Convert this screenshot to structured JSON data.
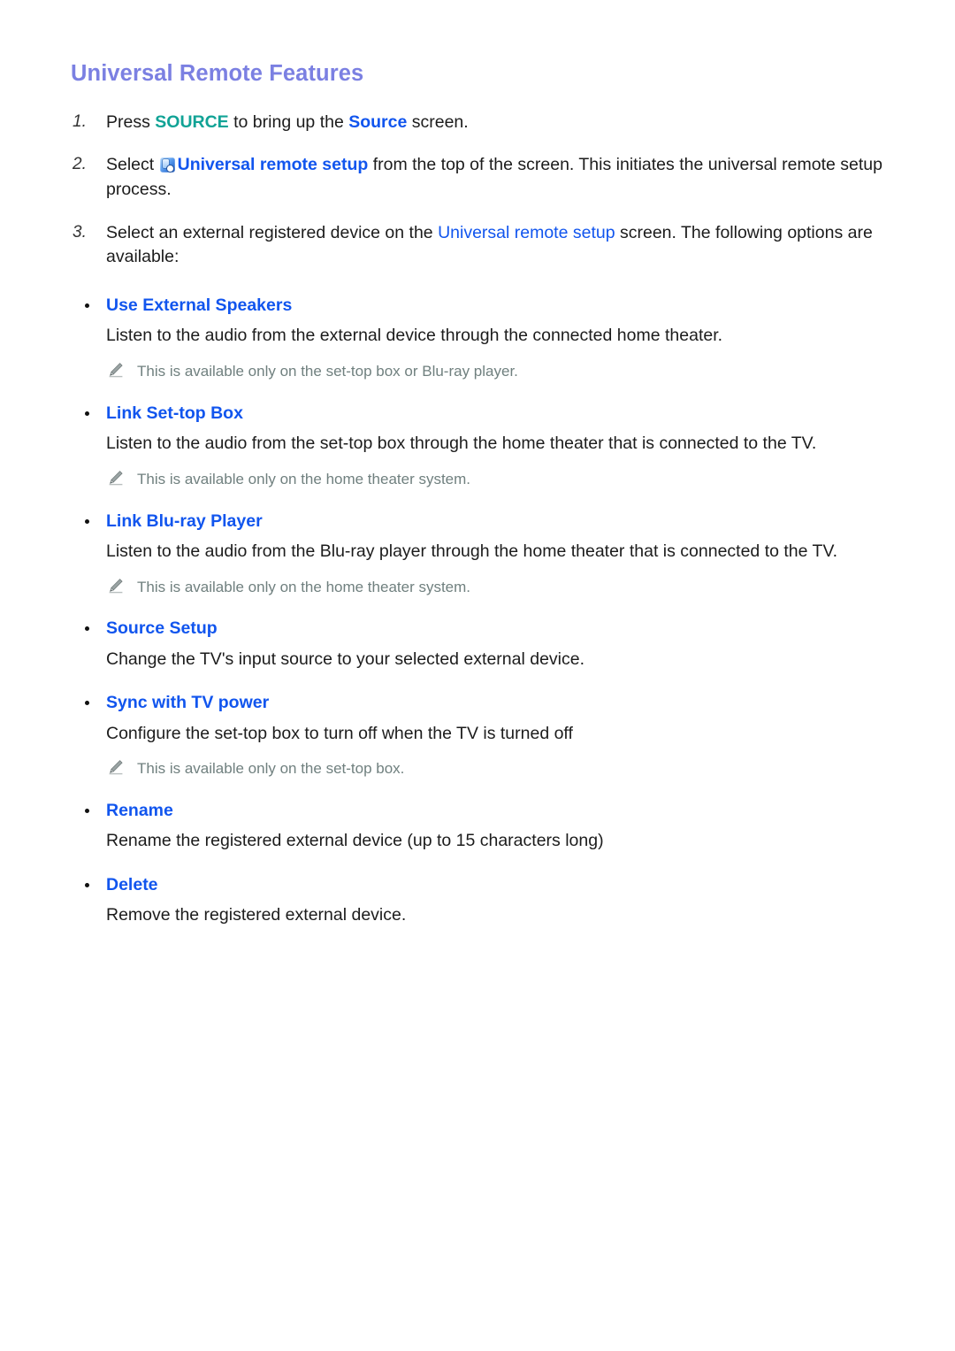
{
  "document": {
    "title": "Universal Remote Features"
  },
  "steps": [
    {
      "number": "1.",
      "pre": "Press ",
      "kw_teal": "SOURCE",
      "mid": " to bring up the ",
      "kw_blue": "Source",
      "post": " screen."
    },
    {
      "number": "2.",
      "pre": "Select ",
      "icon": "universal-remote-setup-icon",
      "kw_blue": "Universal remote setup",
      "post": " from the top of the screen. This initiates the universal remote setup process."
    },
    {
      "number": "3.",
      "pre": "Select an external registered device on the ",
      "kw_blue": "Universal remote setup",
      "post": " screen. The following options are available:"
    }
  ],
  "options": [
    {
      "term": "Use External Speakers",
      "description": "Listen to the audio from the external device through the connected home theater.",
      "note": "This is available only on the set-top box or Blu-ray player."
    },
    {
      "term": "Link Set-top Box",
      "description": "Listen to the audio from the set-top box through the home theater that is connected to the TV.",
      "note": "This is available only on the home theater system."
    },
    {
      "term": "Link Blu-ray Player",
      "description": "Listen to the audio from the Blu-ray player through the home theater that is connected to the TV.",
      "note": "This is available only on the home theater system."
    },
    {
      "term": "Source Setup",
      "description": "Change the TV's input source to your selected external device.",
      "note": null
    },
    {
      "term": "Sync with TV power",
      "description": "Configure the set-top box to turn off when the TV is turned off",
      "note": "This is available only on the set-top box."
    },
    {
      "term": "Rename",
      "description": "Rename the registered external device (up to 15 characters long)",
      "note": null
    },
    {
      "term": "Delete",
      "description": "Remove the registered external device.",
      "note": null
    }
  ],
  "colors": {
    "heading": "#7b80e2",
    "link_blue": "#1155ee",
    "key_teal": "#11a396",
    "note_gray": "#70807f",
    "body_text": "#1c1c1c",
    "background": "#ffffff"
  },
  "icons": {
    "universal_remote_setup": "universal-remote-setup-icon",
    "note": "pencil-icon",
    "bullet": "bullet-dot-icon"
  }
}
